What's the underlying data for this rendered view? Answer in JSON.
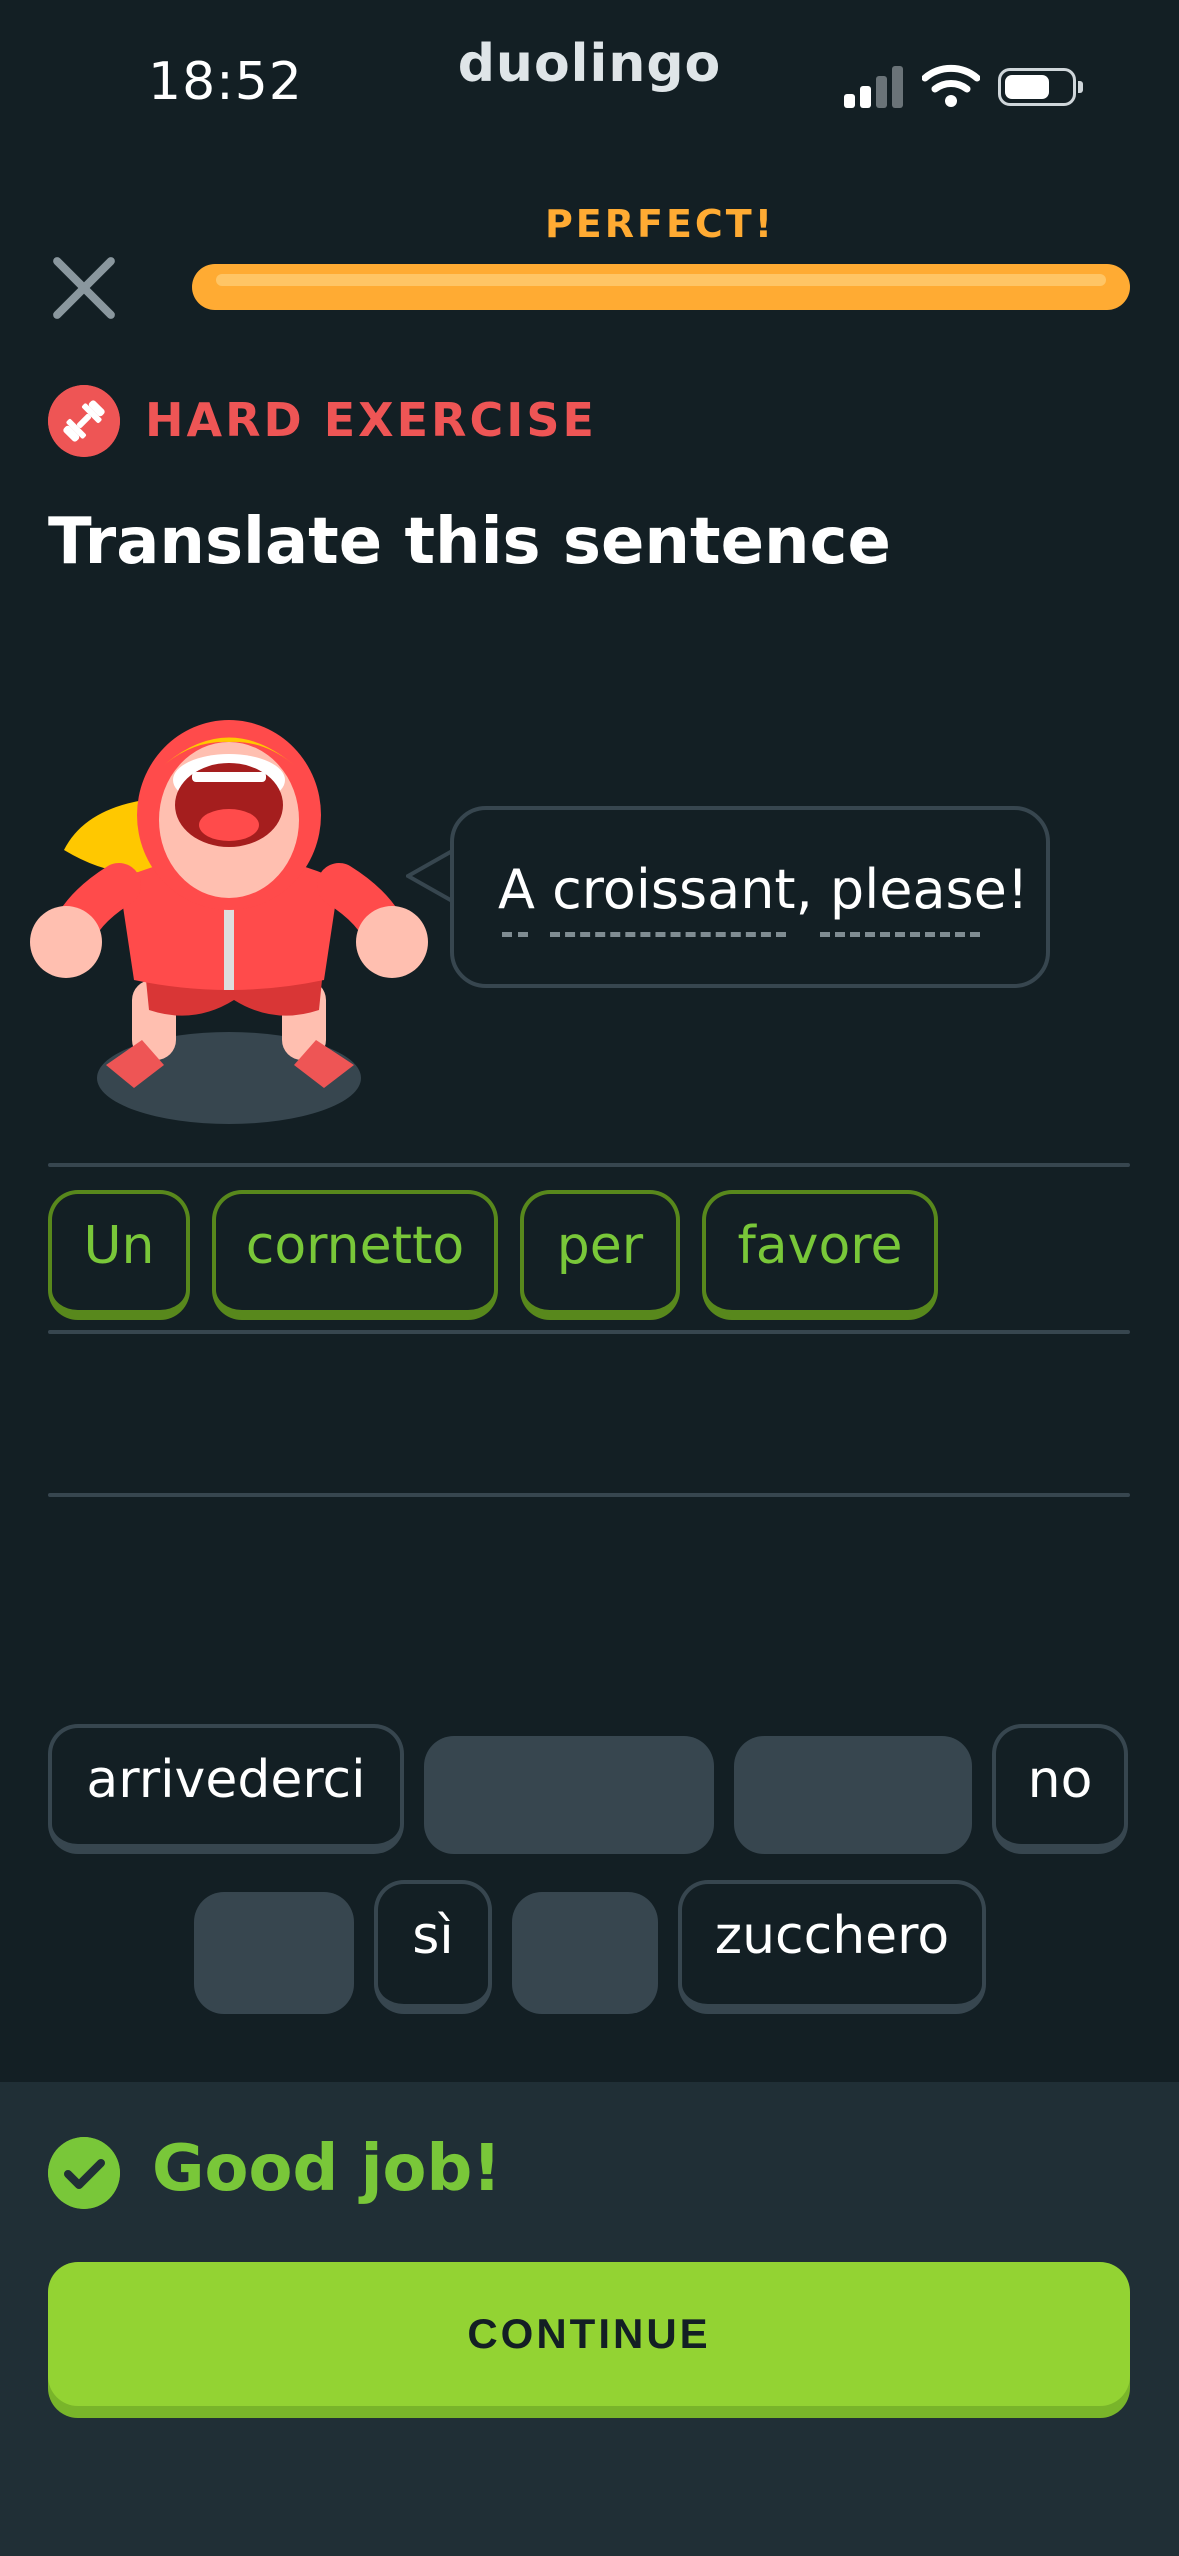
{
  "status_bar": {
    "time": "18:52",
    "brand": "duolingo",
    "icons": [
      "signal-icon",
      "wifi-icon",
      "battery-icon"
    ]
  },
  "header": {
    "close_icon": "close-icon",
    "progress_label": "PERFECT!",
    "progress_fraction": 1.0,
    "progress_color": "#ffab33"
  },
  "exercise": {
    "badge_icon": "dumbbell-icon",
    "badge_label": "HARD EXERCISE",
    "badge_color": "#ee5555",
    "instruction": "Translate this sentence",
    "character": "character-illustration",
    "prompt": "A croissant, please!"
  },
  "answer": {
    "words": [
      "Un",
      "cornetto",
      "per",
      "favore"
    ]
  },
  "word_bank": {
    "row1": [
      "arrivederci",
      "",
      "",
      "no"
    ],
    "row2": [
      "",
      "sì",
      "",
      "zucchero"
    ]
  },
  "feedback": {
    "icon": "checkmark-icon",
    "message": "Good job!",
    "button_label": "CONTINUE",
    "accent": "#79c739",
    "button_color": "#93d333"
  }
}
